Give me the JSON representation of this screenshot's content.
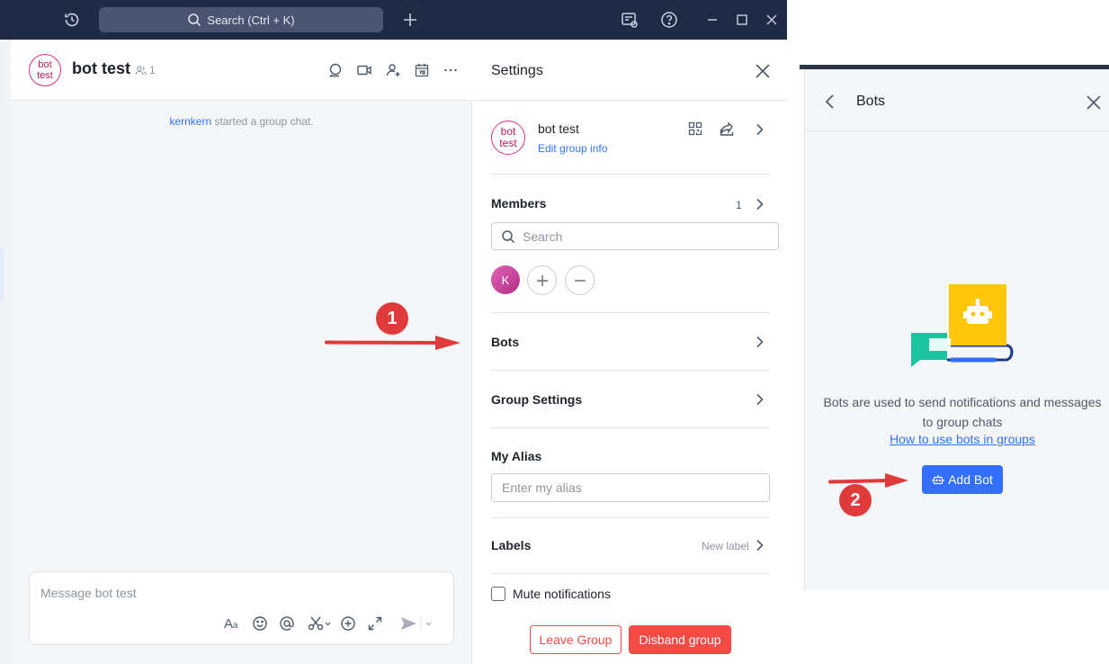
{
  "titlebar": {
    "search_placeholder": "Search (Ctrl + K)",
    "icons": [
      "history-icon",
      "search-icon",
      "plus-icon",
      "notifications-panel-icon",
      "help-icon",
      "minimize-icon",
      "maximize-icon",
      "close-icon"
    ]
  },
  "chat": {
    "avatar_text": "bot test",
    "title": "bot test",
    "member_count": "1",
    "header_icons": [
      "chat-search-icon",
      "video-call-icon",
      "add-member-icon",
      "calendar-icon",
      "more-icon"
    ],
    "system_message": {
      "user": "kernkern",
      "text": " started a group chat."
    },
    "composer": {
      "placeholder": "Message bot test",
      "icons": [
        "text-format-icon",
        "emoji-icon",
        "mention-icon",
        "screenshot-icon",
        "add-icon",
        "expand-icon",
        "send-icon"
      ]
    }
  },
  "settings": {
    "title": "Settings",
    "group": {
      "avatar_text": "bot test",
      "name": "bot test",
      "edit_link": "Edit group info"
    },
    "members": {
      "label": "Members",
      "count": "1",
      "search_placeholder": "Search",
      "member_initial": "K"
    },
    "bots_label": "Bots",
    "group_settings_label": "Group Settings",
    "alias": {
      "label": "My Alias",
      "placeholder": "Enter my alias"
    },
    "labels": {
      "label": "Labels",
      "new_label": "New label"
    },
    "mute_label": "Mute notifications",
    "leave_button": "Leave Group",
    "disband_button": "Disband group"
  },
  "bots_panel": {
    "title": "Bots",
    "description": "Bots are used to send notifications and messages to group chats",
    "link": "How to use bots in groups",
    "add_button": "Add Bot"
  },
  "annotations": {
    "badge_1": "1",
    "badge_2": "2",
    "color": "#e03a3a"
  },
  "colors": {
    "accent": "#3370ff",
    "danger": "#f54a45",
    "titlebar": "#1f2a44",
    "group_avatar": "#d6337f"
  }
}
